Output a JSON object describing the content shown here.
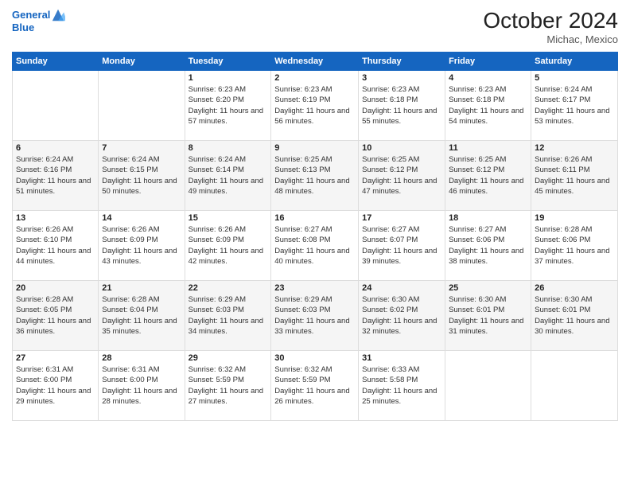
{
  "header": {
    "logo_line1": "General",
    "logo_line2": "Blue",
    "month": "October 2024",
    "location": "Michac, Mexico"
  },
  "weekdays": [
    "Sunday",
    "Monday",
    "Tuesday",
    "Wednesday",
    "Thursday",
    "Friday",
    "Saturday"
  ],
  "weeks": [
    [
      {
        "day": "",
        "sunrise": "",
        "sunset": "",
        "daylight": ""
      },
      {
        "day": "",
        "sunrise": "",
        "sunset": "",
        "daylight": ""
      },
      {
        "day": "1",
        "sunrise": "Sunrise: 6:23 AM",
        "sunset": "Sunset: 6:20 PM",
        "daylight": "Daylight: 11 hours and 57 minutes."
      },
      {
        "day": "2",
        "sunrise": "Sunrise: 6:23 AM",
        "sunset": "Sunset: 6:19 PM",
        "daylight": "Daylight: 11 hours and 56 minutes."
      },
      {
        "day": "3",
        "sunrise": "Sunrise: 6:23 AM",
        "sunset": "Sunset: 6:18 PM",
        "daylight": "Daylight: 11 hours and 55 minutes."
      },
      {
        "day": "4",
        "sunrise": "Sunrise: 6:23 AM",
        "sunset": "Sunset: 6:18 PM",
        "daylight": "Daylight: 11 hours and 54 minutes."
      },
      {
        "day": "5",
        "sunrise": "Sunrise: 6:24 AM",
        "sunset": "Sunset: 6:17 PM",
        "daylight": "Daylight: 11 hours and 53 minutes."
      }
    ],
    [
      {
        "day": "6",
        "sunrise": "Sunrise: 6:24 AM",
        "sunset": "Sunset: 6:16 PM",
        "daylight": "Daylight: 11 hours and 51 minutes."
      },
      {
        "day": "7",
        "sunrise": "Sunrise: 6:24 AM",
        "sunset": "Sunset: 6:15 PM",
        "daylight": "Daylight: 11 hours and 50 minutes."
      },
      {
        "day": "8",
        "sunrise": "Sunrise: 6:24 AM",
        "sunset": "Sunset: 6:14 PM",
        "daylight": "Daylight: 11 hours and 49 minutes."
      },
      {
        "day": "9",
        "sunrise": "Sunrise: 6:25 AM",
        "sunset": "Sunset: 6:13 PM",
        "daylight": "Daylight: 11 hours and 48 minutes."
      },
      {
        "day": "10",
        "sunrise": "Sunrise: 6:25 AM",
        "sunset": "Sunset: 6:12 PM",
        "daylight": "Daylight: 11 hours and 47 minutes."
      },
      {
        "day": "11",
        "sunrise": "Sunrise: 6:25 AM",
        "sunset": "Sunset: 6:12 PM",
        "daylight": "Daylight: 11 hours and 46 minutes."
      },
      {
        "day": "12",
        "sunrise": "Sunrise: 6:26 AM",
        "sunset": "Sunset: 6:11 PM",
        "daylight": "Daylight: 11 hours and 45 minutes."
      }
    ],
    [
      {
        "day": "13",
        "sunrise": "Sunrise: 6:26 AM",
        "sunset": "Sunset: 6:10 PM",
        "daylight": "Daylight: 11 hours and 44 minutes."
      },
      {
        "day": "14",
        "sunrise": "Sunrise: 6:26 AM",
        "sunset": "Sunset: 6:09 PM",
        "daylight": "Daylight: 11 hours and 43 minutes."
      },
      {
        "day": "15",
        "sunrise": "Sunrise: 6:26 AM",
        "sunset": "Sunset: 6:09 PM",
        "daylight": "Daylight: 11 hours and 42 minutes."
      },
      {
        "day": "16",
        "sunrise": "Sunrise: 6:27 AM",
        "sunset": "Sunset: 6:08 PM",
        "daylight": "Daylight: 11 hours and 40 minutes."
      },
      {
        "day": "17",
        "sunrise": "Sunrise: 6:27 AM",
        "sunset": "Sunset: 6:07 PM",
        "daylight": "Daylight: 11 hours and 39 minutes."
      },
      {
        "day": "18",
        "sunrise": "Sunrise: 6:27 AM",
        "sunset": "Sunset: 6:06 PM",
        "daylight": "Daylight: 11 hours and 38 minutes."
      },
      {
        "day": "19",
        "sunrise": "Sunrise: 6:28 AM",
        "sunset": "Sunset: 6:06 PM",
        "daylight": "Daylight: 11 hours and 37 minutes."
      }
    ],
    [
      {
        "day": "20",
        "sunrise": "Sunrise: 6:28 AM",
        "sunset": "Sunset: 6:05 PM",
        "daylight": "Daylight: 11 hours and 36 minutes."
      },
      {
        "day": "21",
        "sunrise": "Sunrise: 6:28 AM",
        "sunset": "Sunset: 6:04 PM",
        "daylight": "Daylight: 11 hours and 35 minutes."
      },
      {
        "day": "22",
        "sunrise": "Sunrise: 6:29 AM",
        "sunset": "Sunset: 6:03 PM",
        "daylight": "Daylight: 11 hours and 34 minutes."
      },
      {
        "day": "23",
        "sunrise": "Sunrise: 6:29 AM",
        "sunset": "Sunset: 6:03 PM",
        "daylight": "Daylight: 11 hours and 33 minutes."
      },
      {
        "day": "24",
        "sunrise": "Sunrise: 6:30 AM",
        "sunset": "Sunset: 6:02 PM",
        "daylight": "Daylight: 11 hours and 32 minutes."
      },
      {
        "day": "25",
        "sunrise": "Sunrise: 6:30 AM",
        "sunset": "Sunset: 6:01 PM",
        "daylight": "Daylight: 11 hours and 31 minutes."
      },
      {
        "day": "26",
        "sunrise": "Sunrise: 6:30 AM",
        "sunset": "Sunset: 6:01 PM",
        "daylight": "Daylight: 11 hours and 30 minutes."
      }
    ],
    [
      {
        "day": "27",
        "sunrise": "Sunrise: 6:31 AM",
        "sunset": "Sunset: 6:00 PM",
        "daylight": "Daylight: 11 hours and 29 minutes."
      },
      {
        "day": "28",
        "sunrise": "Sunrise: 6:31 AM",
        "sunset": "Sunset: 6:00 PM",
        "daylight": "Daylight: 11 hours and 28 minutes."
      },
      {
        "day": "29",
        "sunrise": "Sunrise: 6:32 AM",
        "sunset": "Sunset: 5:59 PM",
        "daylight": "Daylight: 11 hours and 27 minutes."
      },
      {
        "day": "30",
        "sunrise": "Sunrise: 6:32 AM",
        "sunset": "Sunset: 5:59 PM",
        "daylight": "Daylight: 11 hours and 26 minutes."
      },
      {
        "day": "31",
        "sunrise": "Sunrise: 6:33 AM",
        "sunset": "Sunset: 5:58 PM",
        "daylight": "Daylight: 11 hours and 25 minutes."
      },
      {
        "day": "",
        "sunrise": "",
        "sunset": "",
        "daylight": ""
      },
      {
        "day": "",
        "sunrise": "",
        "sunset": "",
        "daylight": ""
      }
    ]
  ]
}
